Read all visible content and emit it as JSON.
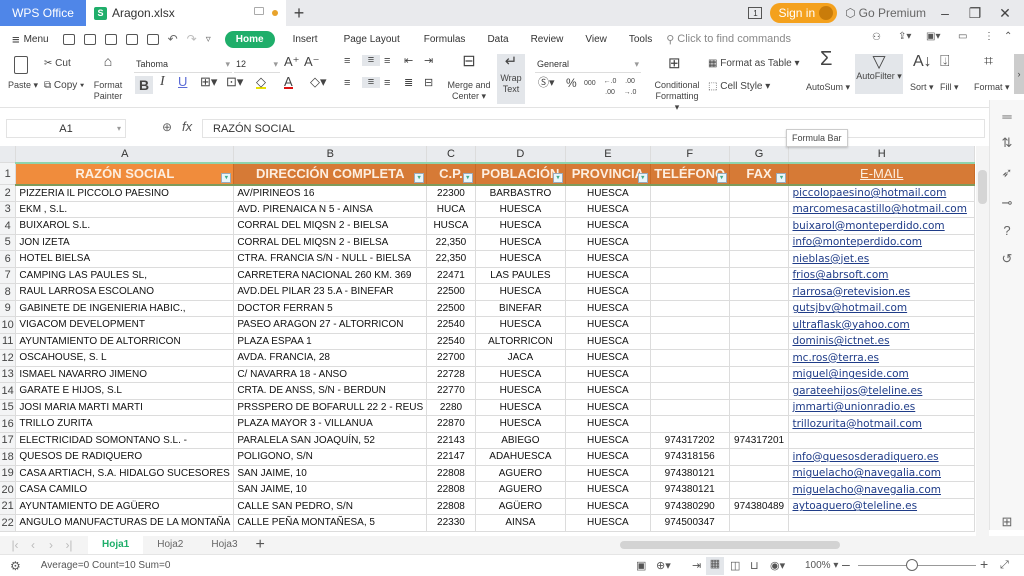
{
  "titlebar": {
    "app_tab": "WPS Office",
    "file_tab": "Aragon.xlsx",
    "file_icon": "S",
    "new_tab": "+",
    "page_count": "1",
    "sign_in": "Sign in",
    "go_premium": "Go Premium",
    "minimize": "–",
    "restore": "❐",
    "close": "✕"
  },
  "menubar": {
    "menu": "Menu",
    "tabs": [
      "Home",
      "Insert",
      "Page Layout",
      "Formulas",
      "Data",
      "Review",
      "View",
      "Tools"
    ],
    "search_placeholder": "Click to find commands"
  },
  "ribbon": {
    "paste": "Paste",
    "cut": "Cut",
    "copy": "Copy",
    "format_painter_1": "Format",
    "format_painter_2": "Painter",
    "font_name": "Tahoma",
    "font_size": "12",
    "bold": "B",
    "italic": "I",
    "underline": "U",
    "merge_center_1": "Merge and",
    "merge_center_2": "Center",
    "wrap_text_1": "Wrap",
    "wrap_text_2": "Text",
    "number_format": "General",
    "currency": "$",
    "percent": "%",
    "thousands": "000",
    "inc_decimal": "←.0 .00",
    "dec_decimal": ".00 →.0",
    "conditional_1": "Conditional",
    "conditional_2": "Formatting",
    "format_as_table": "Format as Table",
    "cell_style": "Cell Style",
    "autosum": "AutoSum",
    "autofilter": "AutoFilter",
    "sort": "Sort",
    "fill": "Fill",
    "format": "Format"
  },
  "formula_bar": {
    "name_box": "A1",
    "fx": "fx",
    "content": "RAZÓN SOCIAL",
    "tooltip": "Formula Bar"
  },
  "sheet": {
    "columns": [
      "A",
      "B",
      "C",
      "D",
      "E",
      "F",
      "G",
      "H"
    ],
    "headers": [
      "RAZÓN SOCIAL",
      "DIRECCIÓN COMPLETA",
      "C.P.",
      "POBLACIÓN",
      "PROVINCIA",
      "TELÉFONO",
      "FAX",
      "E-MAIL"
    ],
    "rows": [
      {
        "n": "2",
        "a": "PIZZERIA IL PICCOLO PAESINO",
        "b": "AV/PIRINEOS 16",
        "c": "22300",
        "d": "BARBASTRO",
        "e": "HUESCA",
        "f": "",
        "g": "",
        "h": "piccolopaesino@hotmail.com"
      },
      {
        "n": "3",
        "a": "EKM , S.L.",
        "b": "AVD. PIRENAICA N 5 - AINSA",
        "c": "HUCA",
        "d": "HUESCA",
        "e": "HUESCA",
        "f": "",
        "g": "",
        "h": "marcomesacastillo@hotmail.com"
      },
      {
        "n": "4",
        "a": "BUIXAROL S.L.",
        "b": "CORRAL DEL MIQSN 2 - BIELSA",
        "c": "HUSCA",
        "d": "HUESCA",
        "e": "HUESCA",
        "f": "",
        "g": "",
        "h": "buixarol@monteperdido.com"
      },
      {
        "n": "5",
        "a": "JON IZETA",
        "b": "CORRAL DEL MIQSN 2 - BIELSA",
        "c": "22,350",
        "d": "HUESCA",
        "e": "HUESCA",
        "f": "",
        "g": "",
        "h": "info@monteperdido.com"
      },
      {
        "n": "6",
        "a": "HOTEL BIELSA",
        "b": "CTRA. FRANCIA S/N - NULL - BIELSA",
        "c": "22,350",
        "d": "HUESCA",
        "e": "HUESCA",
        "f": "",
        "g": "",
        "h": "nieblas@jet.es"
      },
      {
        "n": "7",
        "a": "CAMPING LAS PAULES SL,",
        "b": "CARRETERA NACIONAL 260 KM. 369",
        "c": "22471",
        "d": "LAS PAULES",
        "e": "HUESCA",
        "f": "",
        "g": "",
        "h": "frios@abrsoft.com"
      },
      {
        "n": "8",
        "a": "RAUL LARROSA ESCOLANO",
        "b": "AVD.DEL PILAR 23 5.A - BINEFAR",
        "c": "22500",
        "d": "HUESCA",
        "e": "HUESCA",
        "f": "",
        "g": "",
        "h": "rlarrosa@retevision.es"
      },
      {
        "n": "9",
        "a": "GABINETE DE INGENIERIA HABIC.,",
        "b": "DOCTOR FERRAN 5",
        "c": "22500",
        "d": "BINEFAR",
        "e": "HUESCA",
        "f": "",
        "g": "",
        "h": "gutsjbv@hotmail.com"
      },
      {
        "n": "10",
        "a": "VIGACOM DEVELOPMENT",
        "b": "PASEO ARAGON 27 - ALTORRICON",
        "c": "22540",
        "d": "HUESCA",
        "e": "HUESCA",
        "f": "",
        "g": "",
        "h": "ultraflask@yahoo.com"
      },
      {
        "n": "11",
        "a": "AYUNTAMIENTO DE ALTORRICON",
        "b": "PLAZA ESPAA 1",
        "c": "22540",
        "d": "ALTORRICON",
        "e": "HUESCA",
        "f": "",
        "g": "",
        "h": "dominis@ictnet.es"
      },
      {
        "n": "12",
        "a": "OSCAHOUSE, S. L",
        "b": "AVDA. FRANCIA, 28",
        "c": "22700",
        "d": "JACA",
        "e": "HUESCA",
        "f": "",
        "g": "",
        "h": "mc.ros@terra.es"
      },
      {
        "n": "13",
        "a": "ISMAEL NAVARRO JIMENO",
        "b": "C/ NAVARRA 18 - ANSO",
        "c": "22728",
        "d": "HUESCA",
        "e": "HUESCA",
        "f": "",
        "g": "",
        "h": "miguel@ingeside.com"
      },
      {
        "n": "14",
        "a": "GARATE E HIJOS, S.L",
        "b": "CRTA. DE ANSS, S/N - BERDUN",
        "c": "22770",
        "d": "HUESCA",
        "e": "HUESCA",
        "f": "",
        "g": "",
        "h": "garateehijos@teleline.es"
      },
      {
        "n": "15",
        "a": "JOSI MARIA MARTI MARTI",
        "b": "PRSSPERO DE BOFARULL 22 2 - REUS",
        "c": "2280",
        "d": "HUESCA",
        "e": "HUESCA",
        "f": "",
        "g": "",
        "h": "jmmarti@unionradio.es"
      },
      {
        "n": "16",
        "a": "TRILLO ZURITA",
        "b": "PLAZA MAYOR 3 - VILLANUA",
        "c": "22870",
        "d": "HUESCA",
        "e": "HUESCA",
        "f": "",
        "g": "",
        "h": "trillozurita@hotmail.com"
      },
      {
        "n": "17",
        "a": "ELECTRICIDAD SOMONTANO S.L. -",
        "b": "PARALELA SAN JOAQUÍN, 52",
        "c": "22143",
        "d": "ABIEGO",
        "e": "HUESCA",
        "f": "974317202",
        "g": "974317201",
        "h": ""
      },
      {
        "n": "18",
        "a": "QUESOS DE RADIQUERO",
        "b": "POLIGONO, S/N",
        "c": "22147",
        "d": "ADAHUESCA",
        "e": "HUESCA",
        "f": "974318156",
        "g": "",
        "h": "info@quesosderadiquero.es"
      },
      {
        "n": "19",
        "a": "CASA ARTIACH, S.A. HIDALGO SUCESORES",
        "b": "SAN JAIME, 10",
        "c": "22808",
        "d": "AGUERO",
        "e": "HUESCA",
        "f": "974380121",
        "g": "",
        "h": "miguelacho@navegalia.com"
      },
      {
        "n": "20",
        "a": "CASA CAMILO",
        "b": "SAN JAIME, 10",
        "c": "22808",
        "d": "AGUERO",
        "e": "HUESCA",
        "f": "974380121",
        "g": "",
        "h": "miguelacho@navegalia.com"
      },
      {
        "n": "21",
        "a": "AYUNTAMIENTO DE AGÜERO",
        "b": "CALLE SAN PEDRO, S/N",
        "c": "22808",
        "d": "AGÜERO",
        "e": "HUESCA",
        "f": "974380290",
        "g": "974380489",
        "h": "aytoaguero@teleline.es"
      },
      {
        "n": "22",
        "a": "ANGULO MANUFACTURAS DE LA MONTAÑA",
        "b": "CALLE PEÑA MONTAÑESA, 5",
        "c": "22330",
        "d": "AINSA",
        "e": "HUESCA",
        "f": "974500347",
        "g": "",
        "h": ""
      }
    ]
  },
  "sheet_tabs": {
    "tabs": [
      "Hoja1",
      "Hoja2",
      "Hoja3"
    ],
    "active": "Hoja1",
    "add": "+"
  },
  "status": {
    "summary": "Average=0  Count=10  Sum=0",
    "zoom": "100%"
  },
  "colors": {
    "accent": "#1fae6a",
    "header_fill": "#d67a36",
    "header_selected": "#f08c3c",
    "link": "#1f3c88"
  }
}
